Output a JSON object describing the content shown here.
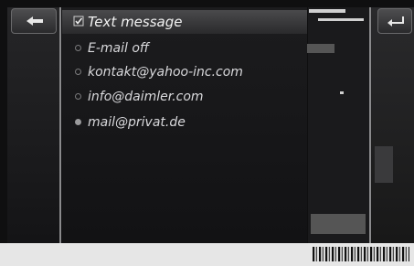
{
  "menu": {
    "items": [
      {
        "label": "Text message",
        "state": "checked",
        "selected": true
      },
      {
        "label": "E-mail off",
        "state": "radio-off",
        "selected": false
      },
      {
        "label": "kontakt@yahoo-inc.com",
        "state": "radio-off",
        "selected": false
      },
      {
        "label": "info@daimler.com",
        "state": "radio-off",
        "selected": false
      },
      {
        "label": "mail@privat.de",
        "state": "radio-on",
        "selected": false
      }
    ]
  },
  "icons": {
    "back": "back-arrow-icon",
    "corner": "return-arrow-icon"
  },
  "colors": {
    "screen_bg": "#0f0f10",
    "text": "#d9d9dc",
    "highlight": "#4a4a4c"
  }
}
